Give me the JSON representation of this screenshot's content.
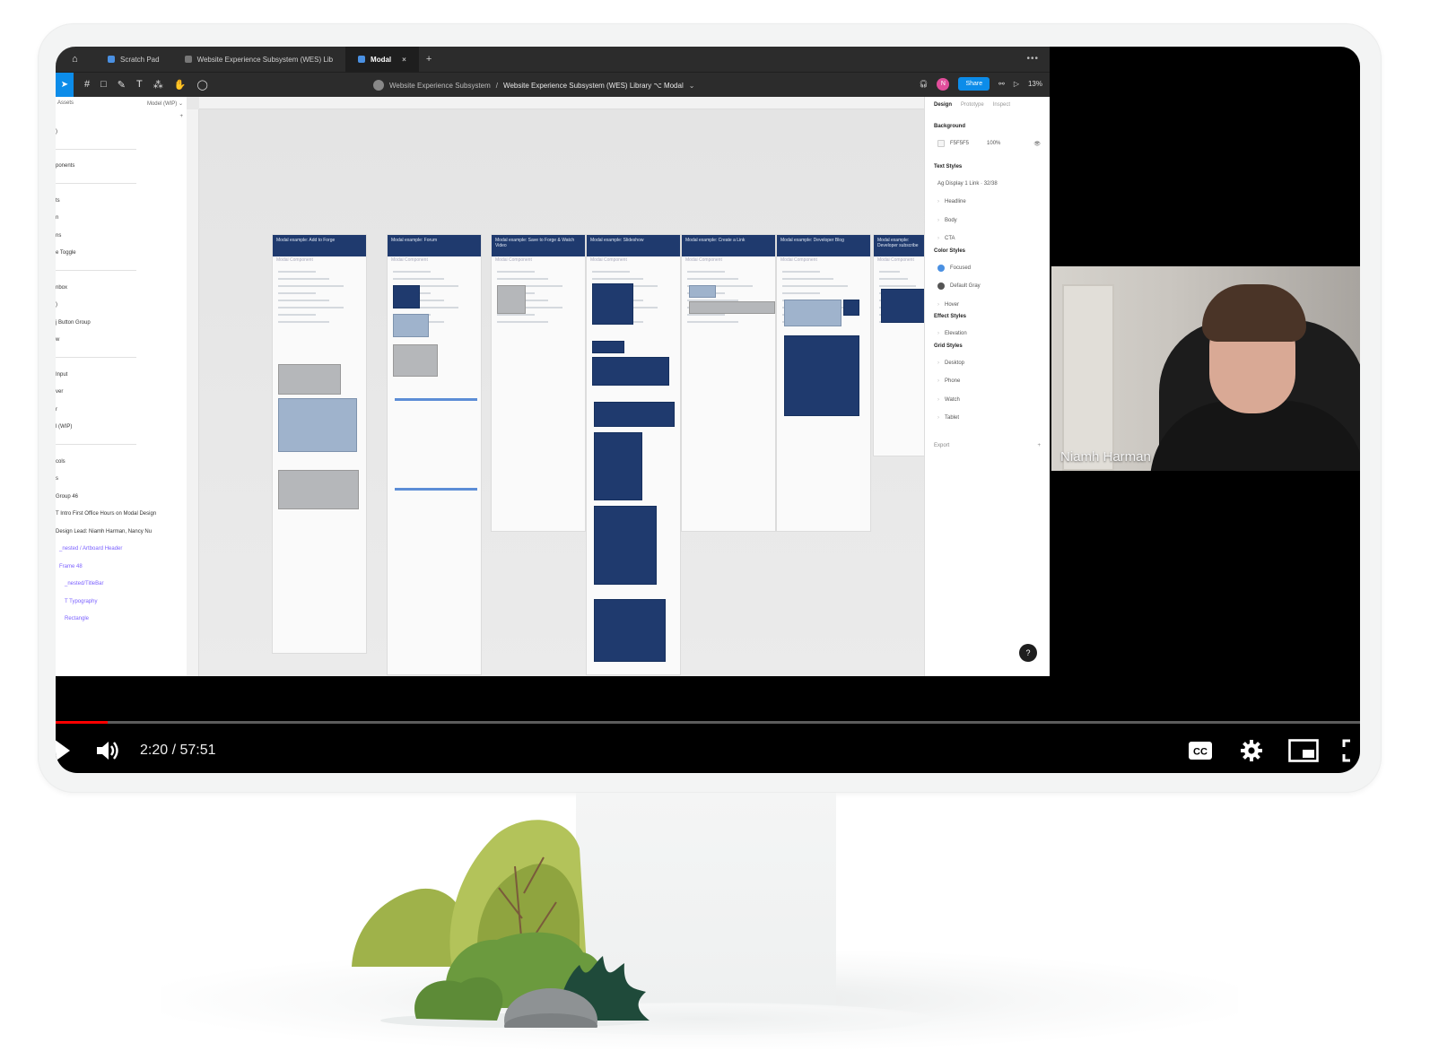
{
  "figma": {
    "tabs": [
      {
        "label": "Scratch Pad"
      },
      {
        "label": "Website Experience Subsystem (WES) Lib"
      },
      {
        "label": "Modal",
        "close": "×"
      }
    ],
    "add_tab": "+",
    "more": "•••",
    "breadcrumb": {
      "team": "Website Experience Subsystem",
      "sep1": "/",
      "file": "Website Experience Subsystem (WES) Library ⌥ Modal",
      "caret": "⌄"
    },
    "share_label": "Share",
    "avatar_initial": "N",
    "zoom": "13%",
    "layers_header_left": "Assets",
    "layers_header_right": "Model (WIP) ⌄",
    "layers_add": "+",
    "layers": [
      ")",
      "",
      "ponents",
      "",
      "ts",
      "n",
      "ns",
      "e Toggle",
      "",
      "nbox",
      ")",
      "j Button Group",
      "w",
      "",
      "Input",
      "ver",
      "r",
      "l (WIP)",
      "",
      "cols",
      "s",
      "Group 46",
      "T  Intro First Office Hours on Modal Design",
      "Design Lead: Niamh Harman, Nancy Nu",
      "_nested / Artboard Header",
      "Frame 48",
      "_nested/TitleBar",
      "T  Typography",
      "Rectangle"
    ],
    "artboards": [
      {
        "title": "Modal example: Add to Forge",
        "sub": "Modal Component"
      },
      {
        "title": "Modal example: Forum",
        "sub": "Modal Component"
      },
      {
        "title": "Modal example: Save to Forge & Watch Video",
        "sub": "Modal Component"
      },
      {
        "title": "Modal example: Slideshow",
        "sub": "Modal Component"
      },
      {
        "title": "Modal example: Create a Link",
        "sub": "Modal Component"
      },
      {
        "title": "Modal example: Developer Blog",
        "sub": "Modal Component"
      },
      {
        "title": "Modal example: Developer subscribe",
        "sub": "Modal Component"
      }
    ],
    "props": {
      "tabs": [
        "Design",
        "Prototype",
        "Inspect"
      ],
      "background_title": "Background",
      "background_hex": "F5F5F5",
      "background_opacity": "100%",
      "text_styles_title": "Text Styles",
      "text_styles": [
        "Ag  Display 1 Link · 32/38",
        "Headline",
        "Body",
        "CTA"
      ],
      "color_styles_title": "Color Styles",
      "color_styles": [
        "Focused",
        "Default Gray",
        "Hover"
      ],
      "effect_styles_title": "Effect Styles",
      "effect_styles": [
        "Elevation"
      ],
      "grid_styles_title": "Grid Styles",
      "grid_styles": [
        "Desktop",
        "Phone",
        "Watch",
        "Tablet"
      ],
      "export_label": "Export",
      "export_add": "+"
    },
    "help": "?"
  },
  "webcam": {
    "participant_name": "Niamh Harman"
  },
  "player": {
    "current_time": "2:20",
    "duration": "57:51",
    "time_display": "2:20 / 57:51",
    "progress_fraction": 0.04,
    "accent_color": "#ff0000",
    "cc_label": "CC"
  },
  "icons": [
    "home-icon",
    "file-icon",
    "play-icon",
    "volume-icon",
    "cc-icon",
    "gear-icon",
    "miniplayer-icon",
    "fullscreen-icon"
  ]
}
